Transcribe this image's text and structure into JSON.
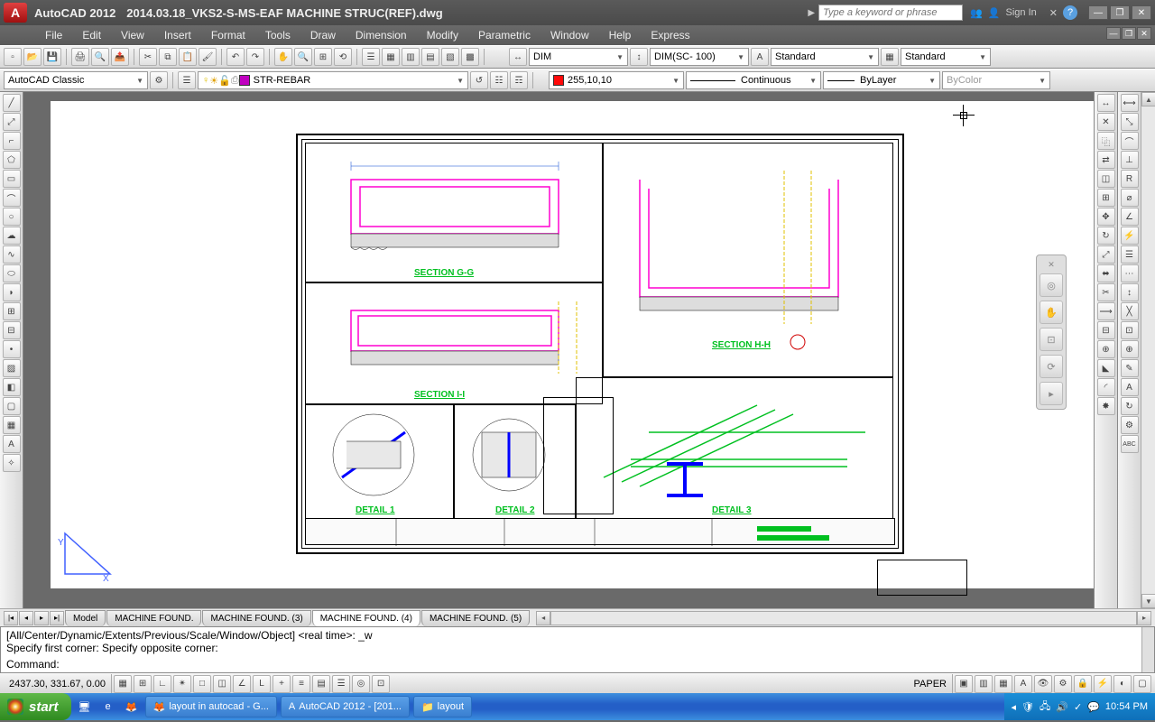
{
  "title": {
    "app": "AutoCAD 2012",
    "file": "2014.03.18_VKS2-S-MS-EAF MACHINE STRUC(REF).dwg"
  },
  "search": {
    "placeholder": "Type a keyword or phrase"
  },
  "signin": "Sign In",
  "menu": [
    "File",
    "Edit",
    "View",
    "Insert",
    "Format",
    "Tools",
    "Draw",
    "Dimension",
    "Modify",
    "Parametric",
    "Window",
    "Help",
    "Express"
  ],
  "toolbar2": {
    "workspace": "AutoCAD Classic",
    "layer": "STR-REBAR",
    "layer_color": "#c000c0"
  },
  "props": {
    "dimstyle": "DIM",
    "dimstyle2": "DIM(SC- 100)",
    "textstyle": "Standard",
    "tablestyle": "Standard",
    "color": "255,10,10",
    "color_sw": "#ff0a0a",
    "linetype": "Continuous",
    "lineweight": "ByLayer",
    "plotstyle": "ByColor"
  },
  "drawing": {
    "section_gg": "SECTION G-G",
    "section_hh": "SECTION H-H",
    "section_h": "SECTION I-I",
    "detail1": "DETAIL 1",
    "detail2": "DETAIL 2",
    "detail3": "DETAIL 3"
  },
  "tabs": [
    "Model",
    "MACHINE FOUND.",
    "MACHINE FOUND. (3)",
    "MACHINE FOUND. (4)",
    "MACHINE FOUND. (5)"
  ],
  "tabs_active": 3,
  "cmd": {
    "l1": "[All/Center/Dynamic/Extents/Previous/Scale/Window/Object] <real time>: _w",
    "l2": "Specify first corner: Specify opposite corner:",
    "l3": "Command:"
  },
  "status": {
    "coords": "2437.30, 331.67, 0.00",
    "space": "PAPER"
  },
  "taskbar": {
    "start": "start",
    "items": [
      "layout in autocad - G...",
      "AutoCAD 2012 - [201...",
      "layout"
    ],
    "time": "10:54 PM"
  }
}
